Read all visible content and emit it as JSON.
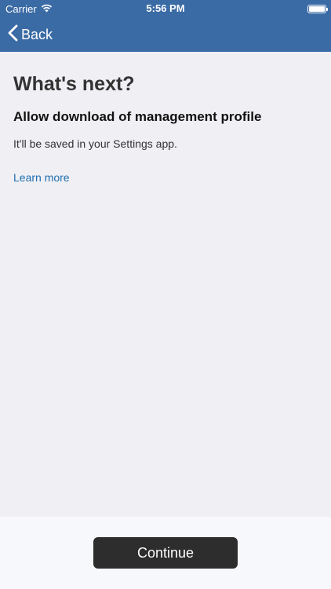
{
  "status_bar": {
    "carrier": "Carrier",
    "time": "5:56 PM",
    "wifi_icon": "wifi-icon",
    "battery_icon": "battery-icon"
  },
  "nav": {
    "back_label": "Back",
    "back_icon": "chevron-left-icon"
  },
  "main": {
    "title": "What's next?",
    "subtitle": "Allow download of management profile",
    "description": "It'll be saved in your Settings app.",
    "learn_more_label": "Learn more"
  },
  "footer": {
    "continue_label": "Continue"
  },
  "colors": {
    "nav_background": "#3B6BA5",
    "page_background": "#EFEFF4",
    "link": "#1F6FAE",
    "button_background": "#2D2D2D"
  }
}
